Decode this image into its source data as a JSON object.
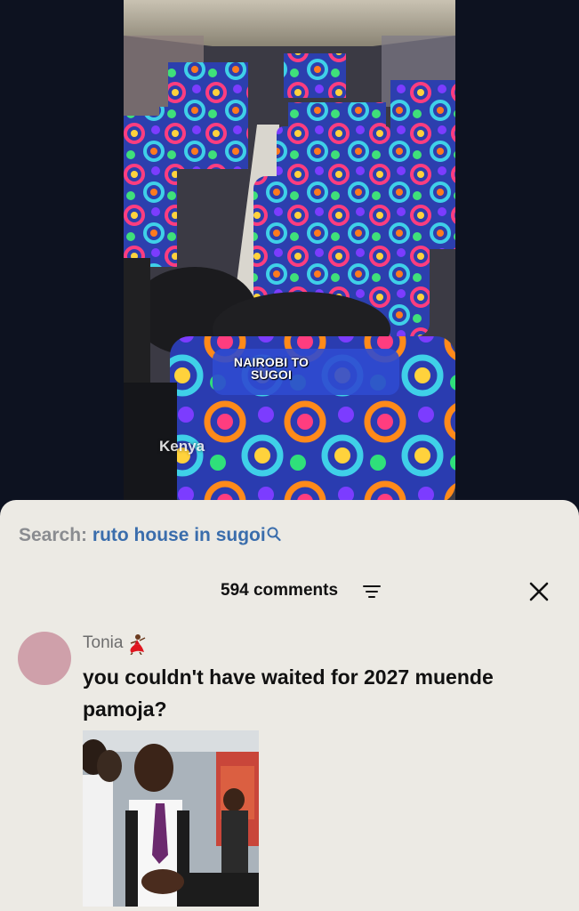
{
  "video": {
    "caption_line1": "NAIROBI TO",
    "caption_line2": "SUGOI",
    "watermark": "Kenya"
  },
  "search": {
    "label": "Search:",
    "query": "ruto house in sugoi",
    "icon": "search-icon"
  },
  "comments": {
    "count_label": "594 comments",
    "sort_icon": "sort-lines-icon",
    "close_icon": "close-icon"
  },
  "comment": {
    "username": "Tonia",
    "username_emoji": "dancer-icon",
    "text": "you couldn't have waited for 2027 muende pamoja?",
    "avatar_color": "#cfa0aa"
  },
  "colors": {
    "sheet_bg": "#eceae4",
    "search_query": "#3a6dac",
    "search_label": "#8a8c90",
    "page_bg": "#0d1220"
  }
}
